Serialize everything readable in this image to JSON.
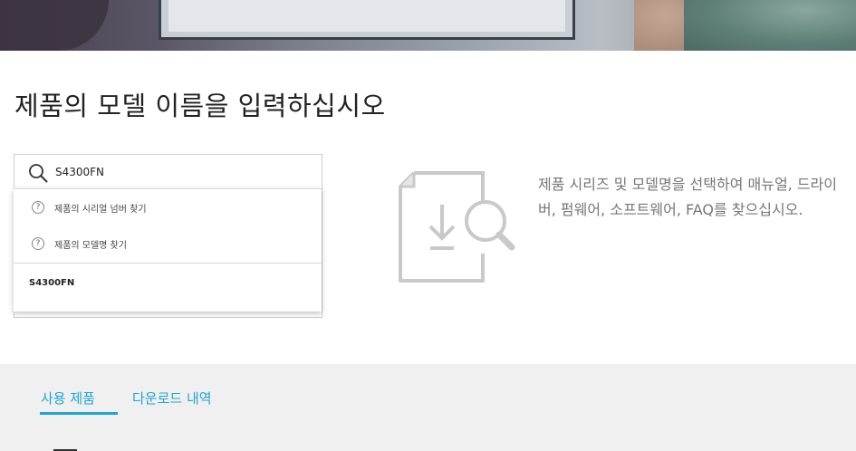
{
  "page": {
    "title": "제품의 모델 이름을 입력하십시오"
  },
  "search": {
    "value": "S4300FN",
    "placeholder": ""
  },
  "dropdown": {
    "help_items": [
      {
        "label": "제품의 시리얼 넘버 찾기",
        "icon": "question-circle-icon"
      },
      {
        "label": "제품의 모델명 찾기",
        "icon": "question-circle-icon"
      }
    ],
    "result": "S4300FN"
  },
  "info": {
    "text": "제품 시리즈 및 모델명을 선택하여 매뉴얼, 드라이버, 펌웨어, 소프트웨어, FAQ를 찾으십시오."
  },
  "tabs": {
    "products": "사용 제품",
    "downloads": "다운로드 내역",
    "active": "products"
  },
  "colors": {
    "accent": "#1ea6d6",
    "muted_text": "#777777",
    "section_bg": "#f0f0f0"
  }
}
